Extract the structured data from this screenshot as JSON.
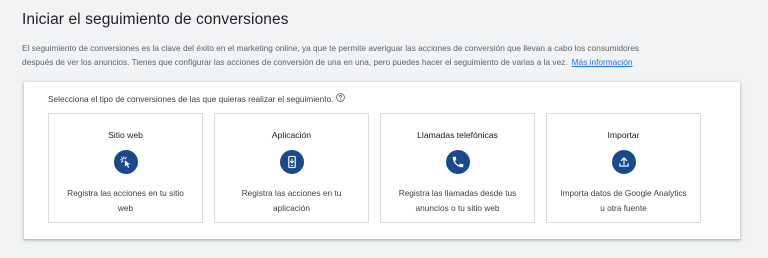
{
  "page": {
    "title": "Iniciar el seguimiento de conversiones",
    "description_line1": "El seguimiento de conversiones es la clave del éxito en el marketing online, ya que te permite averiguar las acciones de conversión que llevan a cabo los consumidores",
    "description_line2": "después de ver los anuncios. Tienes que configurar las acciones de conversión de una en una, pero puedes hacer el seguimiento de varias a la vez.",
    "learn_more": "Más información"
  },
  "card": {
    "prompt": "Selecciona el tipo de conversiones de las que quieras realizar el seguimiento.",
    "options": [
      {
        "title": "Sitio web",
        "icon": "cursor-click-icon",
        "description": "Registra las acciones en tu sitio web"
      },
      {
        "title": "Aplicación",
        "icon": "mobile-app-icon",
        "description": "Registra las acciones en tu aplicación"
      },
      {
        "title": "Llamadas telefónicas",
        "icon": "phone-icon",
        "description": "Registra las llamadas desde tus anuncios o tu sitio web"
      },
      {
        "title": "Importar",
        "icon": "upload-icon",
        "description": "Importa datos de Google Analytics u otra fuente"
      }
    ]
  },
  "colors": {
    "accent": "#1a73e8",
    "icon_bg": "#1a4a8c",
    "background": "#f1f3f4"
  }
}
